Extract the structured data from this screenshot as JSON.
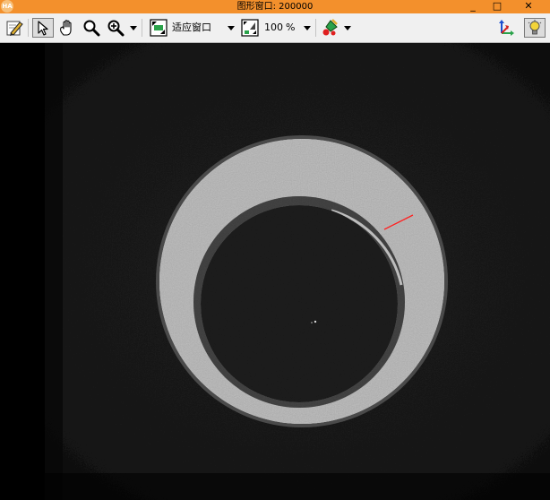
{
  "window": {
    "title": "图形窗口: 200000",
    "app_icon_text": "HA",
    "minimize_glyph": "_",
    "maximize_glyph": "□",
    "close_glyph": "✕"
  },
  "toolbar": {
    "fit_window_label": "适应窗口",
    "zoom_value": "100",
    "zoom_unit": "%"
  },
  "icons": {
    "edit": "pencil-icon",
    "pointer": "pointer-icon",
    "pan": "hand-icon",
    "zoom": "magnifier-icon",
    "zoom_in": "zoom-in-icon",
    "fit": "fit-window-icon",
    "zoom_percent": "zoom-percent-icon",
    "color": "paint-icon",
    "axes": "axes-icon",
    "bulb": "bulb-icon"
  },
  "colors": {
    "title_bar": "#f3902c",
    "toolbar_bg": "#f0f0f0",
    "measure_line": "#ff2020"
  }
}
